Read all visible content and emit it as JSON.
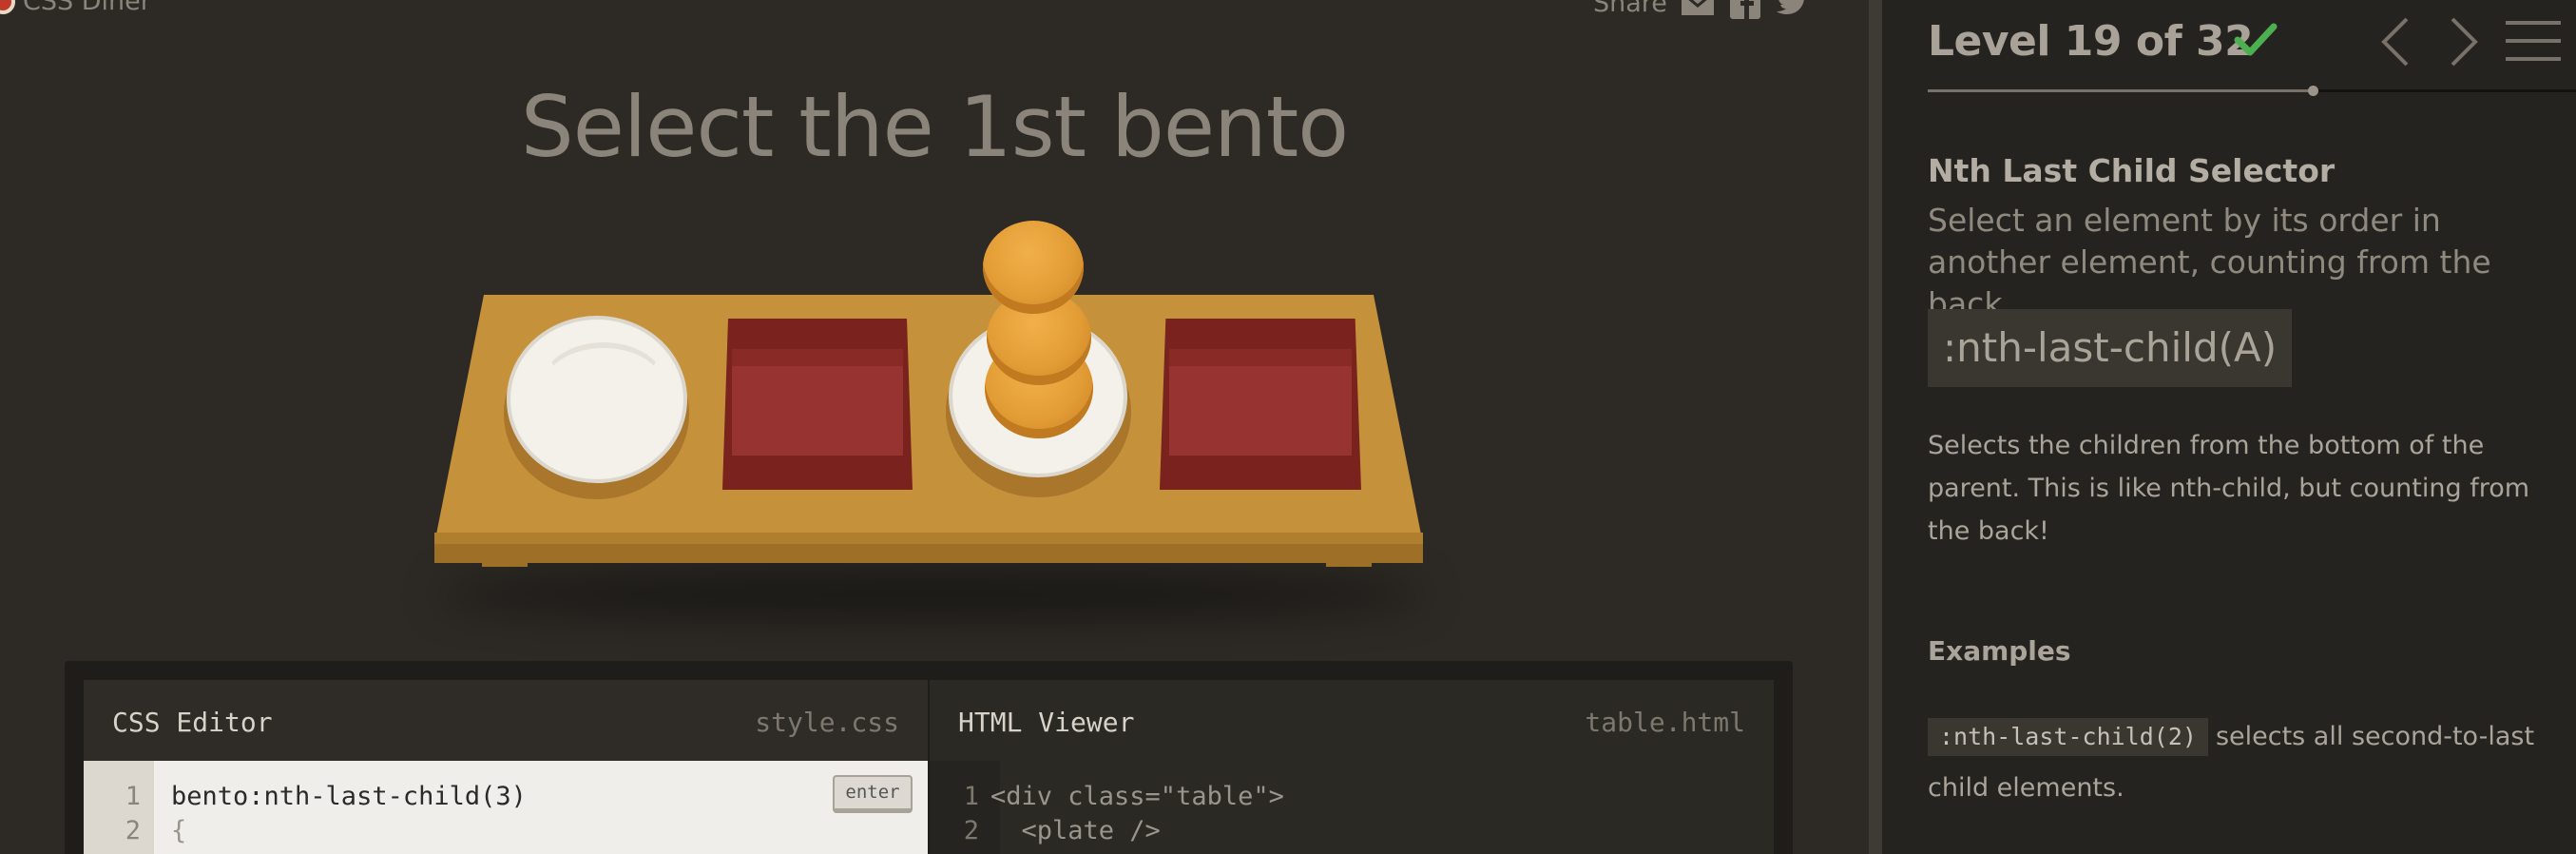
{
  "header": {
    "logo_text": "CSS Diner",
    "share_label": "Share"
  },
  "game": {
    "instruction": "Select the 1st bento"
  },
  "editor": {
    "css_pane": {
      "title": "CSS Editor",
      "filename": "style.css",
      "enter_label": "enter",
      "lines": [
        {
          "num": "1",
          "text": "bento:nth-last-child(3)"
        },
        {
          "num": "2",
          "text": "{"
        }
      ]
    },
    "html_pane": {
      "title": "HTML Viewer",
      "filename": "table.html",
      "lines": [
        {
          "num": "1",
          "text": "<div class=\"table\">"
        },
        {
          "num": "2",
          "text": "  <plate />"
        }
      ]
    }
  },
  "sidebar": {
    "level_title": "Level 19 of 32",
    "level_completed": true,
    "progress": {
      "current": 19,
      "total": 32
    },
    "selector_name": "Nth Last Child Selector",
    "selector_title": "Select an element by its order in another element, counting from the back",
    "syntax": ":nth-last-child(A)",
    "hint": "Selects the children from the bottom of the parent. This is like nth-child, but counting from the back!",
    "examples_heading": "Examples",
    "example": {
      "code": ":nth-last-child(2)",
      "text": "selects all second-to-last child elements."
    }
  },
  "colors": {
    "background": "#2d2a25",
    "sidebar": "#25231f",
    "check": "#4caf50",
    "table": "#c6913b",
    "bento": "#7a221d",
    "orange": "#e29c35"
  },
  "icons": [
    "logo-icon",
    "mail-icon",
    "facebook-icon",
    "twitter-icon",
    "check-icon",
    "chevron-left-icon",
    "chevron-right-icon",
    "menu-icon"
  ]
}
